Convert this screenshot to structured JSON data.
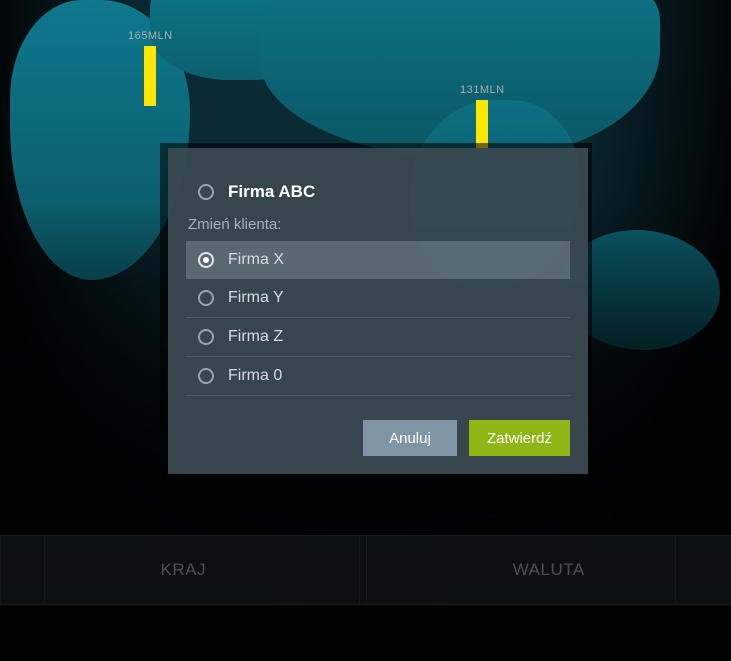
{
  "map": {
    "markers": [
      {
        "label": "165MLN"
      },
      {
        "label": "131MLN"
      }
    ]
  },
  "modal": {
    "current_client": "Firma ABC",
    "caption": "Zmień klienta:",
    "options": [
      {
        "label": "Firma X",
        "selected": true
      },
      {
        "label": "Firma Y",
        "selected": false
      },
      {
        "label": "Firma Z",
        "selected": false
      },
      {
        "label": "Firma 0",
        "selected": false
      }
    ],
    "cancel_label": "Anuluj",
    "confirm_label": "Zatwierdź"
  },
  "tabs": {
    "left": "KRAJ",
    "right": "WALUTA"
  }
}
